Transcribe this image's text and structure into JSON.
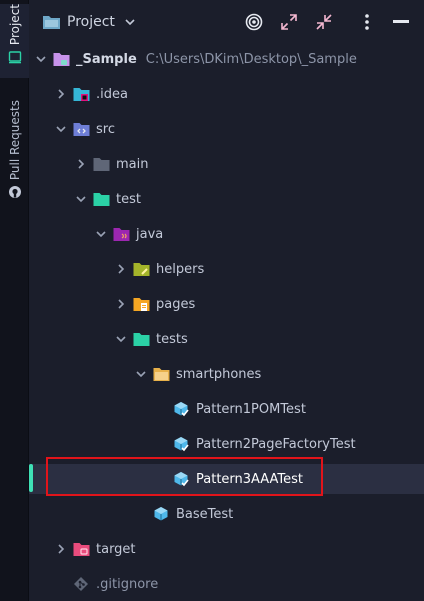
{
  "sidebar": {
    "tabs": [
      {
        "label": "Project",
        "icon": "folder-window-icon",
        "active": true
      },
      {
        "label": "Pull Requests",
        "icon": "github-icon",
        "active": false
      }
    ]
  },
  "header": {
    "title": "Project",
    "icons": [
      "locate-target-icon",
      "expand-all-icon",
      "collapse-all-icon",
      "more-options-icon",
      "minimize-icon"
    ]
  },
  "tree": [
    {
      "name": "_Sample",
      "path": "C:\\Users\\DKim\\Desktop\\_Sample",
      "icon": "module-folder-icon",
      "state": "expanded"
    },
    {
      "name": ".idea",
      "icon": "idea-folder-icon",
      "state": "collapsed"
    },
    {
      "name": "src",
      "icon": "source-folder-icon",
      "state": "expanded"
    },
    {
      "name": "main",
      "icon": "folder-icon",
      "state": "collapsed"
    },
    {
      "name": "test",
      "icon": "test-folder-icon",
      "state": "expanded"
    },
    {
      "name": "java",
      "icon": "java-folder-icon",
      "state": "expanded"
    },
    {
      "name": "helpers",
      "icon": "helpers-folder-icon",
      "state": "collapsed"
    },
    {
      "name": "pages",
      "icon": "pages-folder-icon",
      "state": "collapsed"
    },
    {
      "name": "tests",
      "icon": "tests-folder-icon",
      "state": "expanded"
    },
    {
      "name": "smartphones",
      "icon": "package-folder-icon",
      "state": "expanded"
    },
    {
      "name": "Pattern1POMTest",
      "icon": "java-test-class-icon"
    },
    {
      "name": "Pattern2PageFactoryTest",
      "icon": "java-test-class-icon"
    },
    {
      "name": "Pattern3AAATest",
      "icon": "java-test-class-icon",
      "selected": true
    },
    {
      "name": "BaseTest",
      "icon": "java-class-icon"
    },
    {
      "name": "target",
      "icon": "target-folder-icon",
      "state": "collapsed"
    },
    {
      "name": ".gitignore",
      "icon": "git-file-icon",
      "ignored": true
    }
  ],
  "colors": {
    "background": "#1b1e2b",
    "selection": "#2b2f42",
    "highlight_border": "#e1141a",
    "accent": "#3fe0b5"
  }
}
